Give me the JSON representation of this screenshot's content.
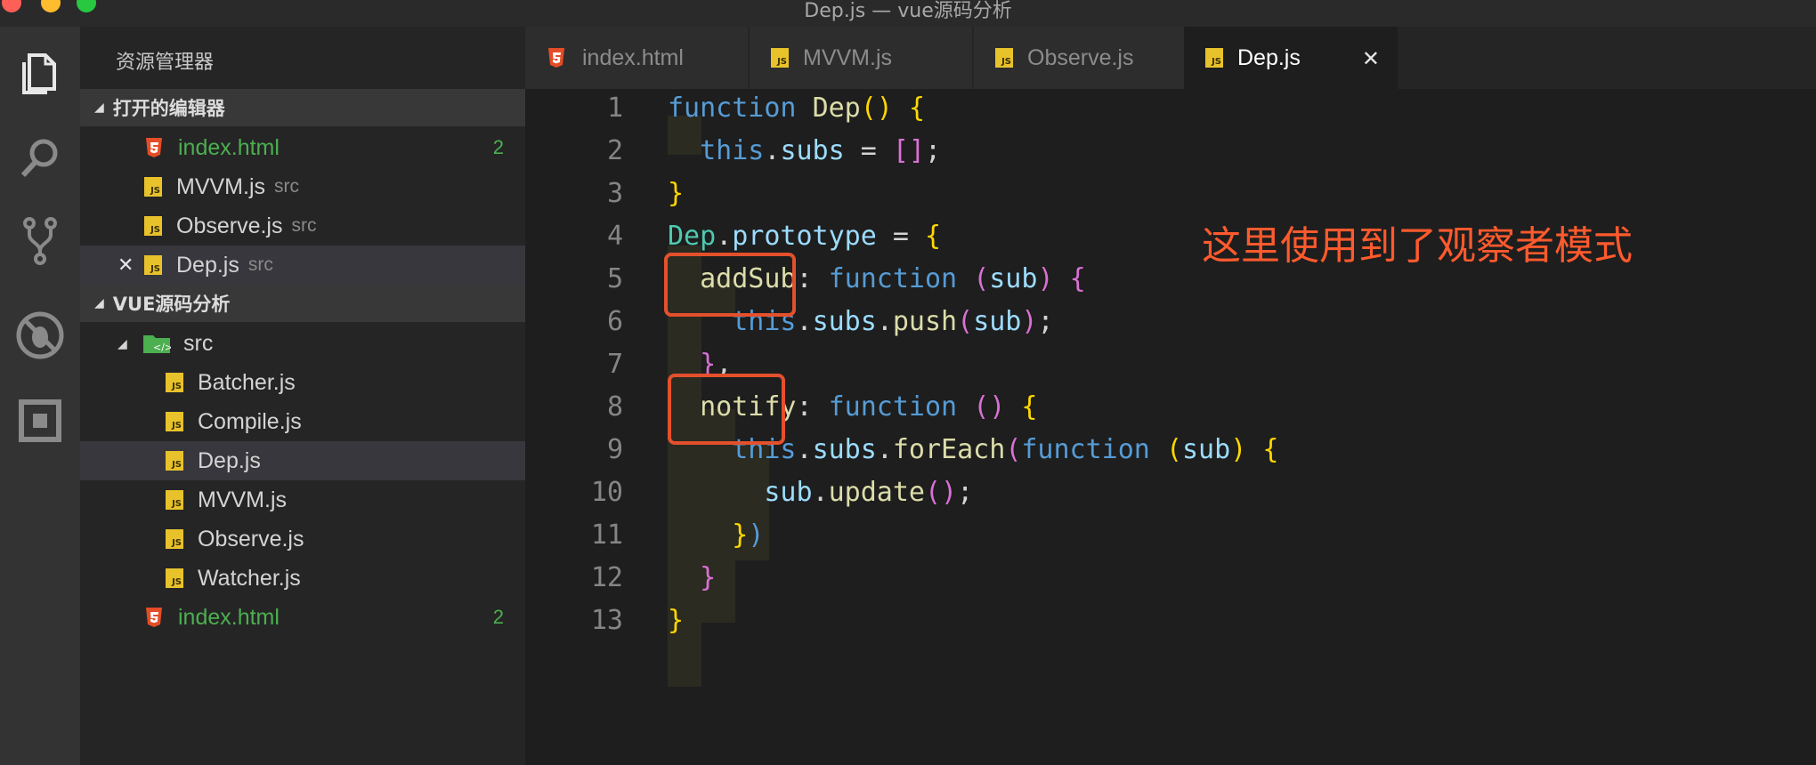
{
  "window": {
    "title": "Dep.js — vue源码分析"
  },
  "colors": {
    "close": "#fe5f57",
    "minimize": "#febc2e",
    "zoom": "#28c840",
    "annotation": "#ff5a2d"
  },
  "activity_bar": [
    "files-icon",
    "search-icon",
    "source-control-icon",
    "debug-icon",
    "extensions-icon"
  ],
  "sidebar": {
    "title": "资源管理器",
    "open_editors": {
      "label": "打开的编辑器",
      "items": [
        {
          "name": "index.html",
          "badge": "2"
        },
        {
          "name": "MVVM.js",
          "dir": "src"
        },
        {
          "name": "Observe.js",
          "dir": "src"
        },
        {
          "name": "Dep.js",
          "dir": "src",
          "close": "✕"
        }
      ]
    },
    "project": {
      "label": "VUE源码分析",
      "folder": "src",
      "files": [
        "Batcher.js",
        "Compile.js",
        "Dep.js",
        "MVVM.js",
        "Observe.js",
        "Watcher.js"
      ],
      "root_file": {
        "name": "index.html",
        "badge": "2"
      }
    }
  },
  "tabs": [
    {
      "label": "index.html"
    },
    {
      "label": "MVVM.js"
    },
    {
      "label": "Observe.js"
    },
    {
      "label": "Dep.js",
      "close": "✕"
    }
  ],
  "editor": {
    "line_numbers": [
      "1",
      "2",
      "3",
      "4",
      "5",
      "6",
      "7",
      "8",
      "9",
      "10",
      "11",
      "12",
      "13"
    ],
    "tokens": {
      "kw_function": "function",
      "dep": "Dep",
      "prototype": "prototype",
      "this": "this",
      "subs": "subs",
      "push": "push",
      "forEach": "forEach",
      "sub": "sub",
      "update": "update",
      "addSub": "addSub",
      "notify": "notify"
    }
  },
  "annotation": {
    "text": "这里使用到了观察者模式"
  }
}
